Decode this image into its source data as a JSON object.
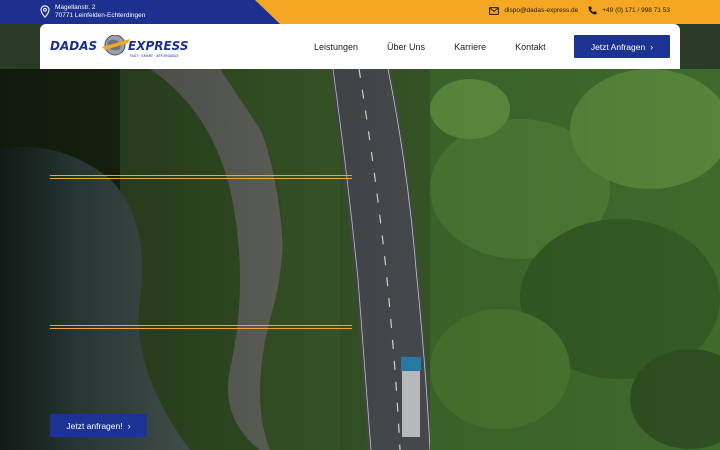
{
  "topbar": {
    "address_line1": "Magellanstr. 2",
    "address_line2": "70771 Leinfelden-Echterdingen",
    "email": "dispo@dadas-express.de",
    "phone": "+49 (0) 171 / 998 71 53",
    "icons": [
      "location-pin-icon",
      "mail-icon",
      "phone-icon"
    ]
  },
  "header": {
    "logo_text_left": "DADAS",
    "logo_text_right": "EXPRESS",
    "logo_tagline": "FAST · SMART · AFFORDABLE",
    "nav": [
      "Leistungen",
      "Über Uns",
      "Karriere",
      "Kontakt"
    ],
    "cta_label": "Jetzt Anfragen"
  },
  "hero": {
    "headline": "",
    "subline": "",
    "cta_label": "Jetzt anfragen!"
  },
  "colors": {
    "brand_blue": "#1d3393",
    "accent_orange": "#f5a623",
    "topbar_blue": "#1d2f8f"
  }
}
